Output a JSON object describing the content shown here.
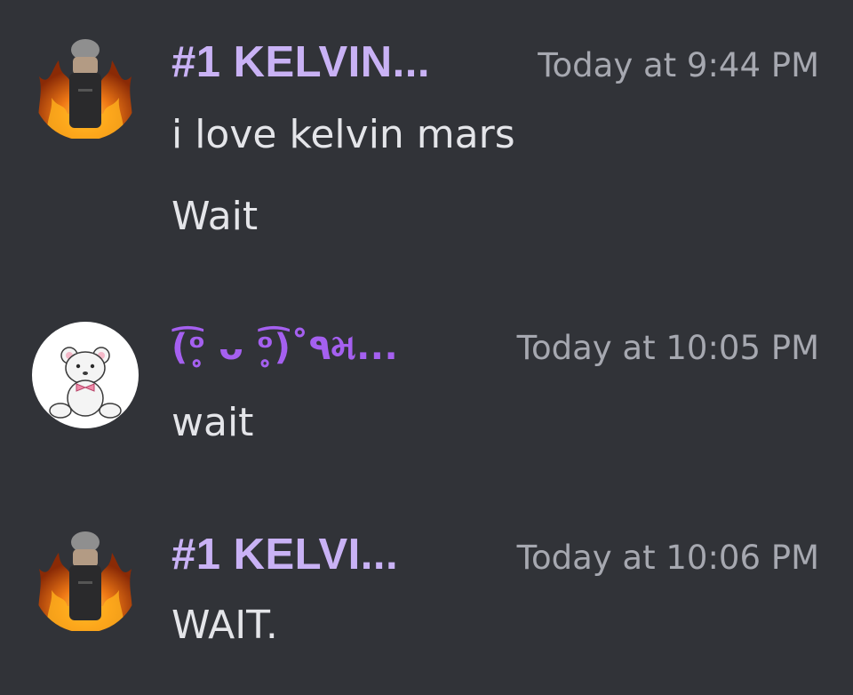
{
  "messages": [
    {
      "avatar_icon": "flaming-figure-avatar-icon",
      "username": "#1 KELVIN...",
      "timestamp": "Today at 9:44 PM",
      "lines": [
        "i love kelvin mars",
        "Wait"
      ]
    },
    {
      "avatar_icon": "teddy-bear-avatar-icon",
      "username": "(͡ᵒ̥ ᴗ ᵒ̥͡)˚٩મ...",
      "timestamp": "Today at 10:05 PM",
      "lines": [
        "wait"
      ]
    },
    {
      "avatar_icon": "flaming-figure-avatar-icon",
      "username": "#1 KELVI...",
      "timestamp": "Today at 10:06 PM",
      "lines": [
        "WAIT."
      ]
    }
  ],
  "colors": {
    "background": "#313338",
    "username_primary": "#c9b2f5",
    "username_secondary": "#a560f0",
    "timestamp": "#a6a8b0",
    "message_text": "#e4e5e9"
  }
}
